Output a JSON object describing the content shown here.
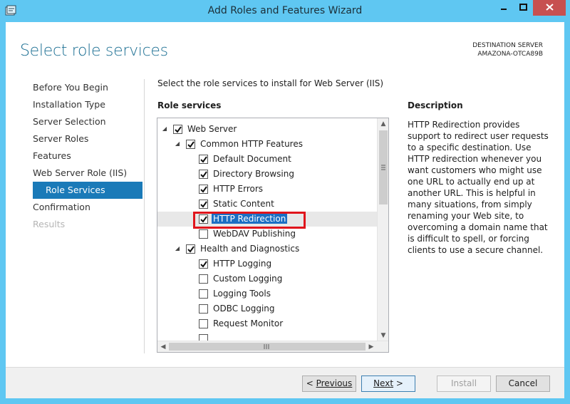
{
  "window": {
    "title": "Add Roles and Features Wizard"
  },
  "header": {
    "page_title": "Select role services",
    "dest_label": "DESTINATION SERVER",
    "dest_server": "AMAZONA-OTCA89B"
  },
  "nav": {
    "items": [
      {
        "label": "Before You Begin",
        "state": "normal"
      },
      {
        "label": "Installation Type",
        "state": "normal"
      },
      {
        "label": "Server Selection",
        "state": "normal"
      },
      {
        "label": "Server Roles",
        "state": "normal"
      },
      {
        "label": "Features",
        "state": "normal"
      },
      {
        "label": "Web Server Role (IIS)",
        "state": "normal"
      },
      {
        "label": "Role Services",
        "state": "active"
      },
      {
        "label": "Confirmation",
        "state": "normal"
      },
      {
        "label": "Results",
        "state": "disabled"
      }
    ]
  },
  "main": {
    "intro": "Select the role services to install for Web Server (IIS)",
    "role_services_label": "Role services",
    "tree": [
      {
        "label": "Web Server",
        "level": 0,
        "expander": true,
        "checked": true
      },
      {
        "label": "Common HTTP Features",
        "level": 1,
        "expander": true,
        "checked": true
      },
      {
        "label": "Default Document",
        "level": 2,
        "expander": false,
        "checked": true
      },
      {
        "label": "Directory Browsing",
        "level": 2,
        "expander": false,
        "checked": true
      },
      {
        "label": "HTTP Errors",
        "level": 2,
        "expander": false,
        "checked": true
      },
      {
        "label": "Static Content",
        "level": 2,
        "expander": false,
        "checked": true
      },
      {
        "label": "HTTP Redirection",
        "level": 2,
        "expander": false,
        "checked": true,
        "selected": true
      },
      {
        "label": "WebDAV Publishing",
        "level": 2,
        "expander": false,
        "checked": false
      },
      {
        "label": "Health and Diagnostics",
        "level": 1,
        "expander": true,
        "checked": true
      },
      {
        "label": "HTTP Logging",
        "level": 2,
        "expander": false,
        "checked": true
      },
      {
        "label": "Custom Logging",
        "level": 2,
        "expander": false,
        "checked": false
      },
      {
        "label": "Logging Tools",
        "level": 2,
        "expander": false,
        "checked": false
      },
      {
        "label": "ODBC Logging",
        "level": 2,
        "expander": false,
        "checked": false
      },
      {
        "label": "Request Monitor",
        "level": 2,
        "expander": false,
        "checked": false
      },
      {
        "label": "",
        "level": 2,
        "expander": false,
        "checked": false
      }
    ]
  },
  "description": {
    "label": "Description",
    "text": "HTTP Redirection provides support to redirect user requests to a specific destination. Use HTTP redirection whenever you want customers who might use one URL to actually end up at another URL. This is helpful in many situations, from simply renaming your Web site, to overcoming a domain name that is difficult to spell, or forcing clients to use a secure channel."
  },
  "footer": {
    "previous": "Previous",
    "next": "Next",
    "install": "Install",
    "cancel": "Cancel"
  },
  "colors": {
    "title_bar": "#5fc7f2",
    "accent": "#1a7ab8",
    "heading": "#1c6f93",
    "close": "#c75050",
    "highlight_box": "#e0151c"
  },
  "icons": [
    "wizard-app-icon",
    "minimize-icon",
    "maximize-icon",
    "close-icon",
    "expand-arrow-icon",
    "checkbox-check-icon",
    "scroll-up-icon",
    "scroll-down-icon",
    "scroll-left-icon",
    "scroll-right-icon",
    "scroll-grip-icon"
  ]
}
